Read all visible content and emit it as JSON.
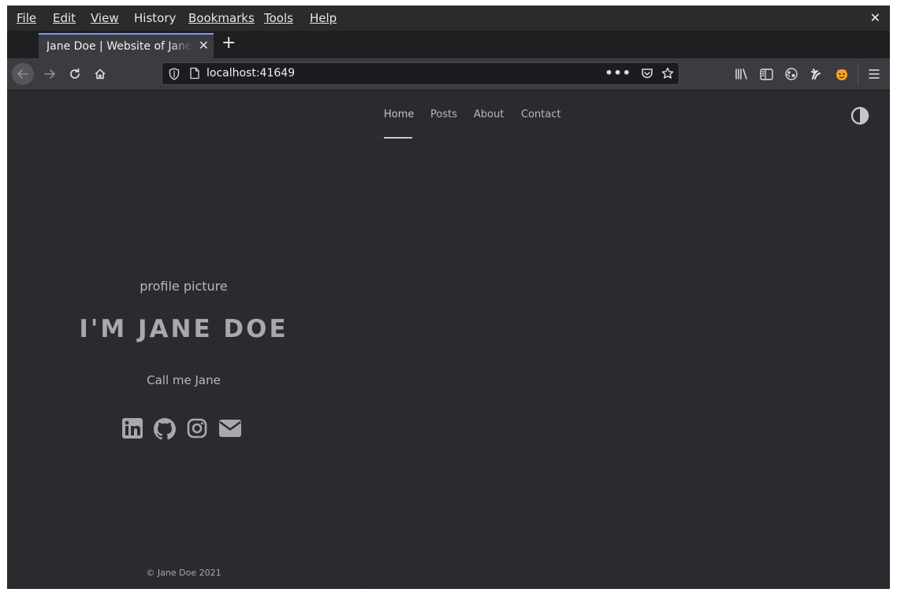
{
  "menubar": {
    "items": [
      {
        "label": "File"
      },
      {
        "label": "Edit"
      },
      {
        "label": "View"
      },
      {
        "label": "History"
      },
      {
        "label": "Bookmarks"
      },
      {
        "label": "Tools"
      },
      {
        "label": "Help"
      }
    ],
    "close_glyph": "✕"
  },
  "tabs": [
    {
      "title": "Jane Doe | Website of Jane Doe",
      "close_glyph": "✕"
    }
  ],
  "new_tab_glyph": "+",
  "urlbar": {
    "url": "localhost:41649",
    "more_glyph": "•••"
  },
  "toolbar_icons": [
    "library-icon",
    "sidebar-icon",
    "extension-icon",
    "extension-icon-2",
    "extension-icon-3",
    "menu-icon"
  ],
  "page": {
    "nav": [
      {
        "label": "Home",
        "active": true
      },
      {
        "label": "Posts"
      },
      {
        "label": "About"
      },
      {
        "label": "Contact"
      }
    ],
    "profile_alt": "profile picture",
    "hero_name": "I'm Jane Doe",
    "tagline": "Call me Jane",
    "social": [
      "linkedin-icon",
      "github-icon",
      "instagram-icon",
      "email-icon"
    ],
    "footer": "© Jane Doe 2021"
  },
  "colors": {
    "page_bg": "#2a2b2e",
    "text": "#b9b9bd",
    "accent_tab": "#6e9ff8"
  }
}
